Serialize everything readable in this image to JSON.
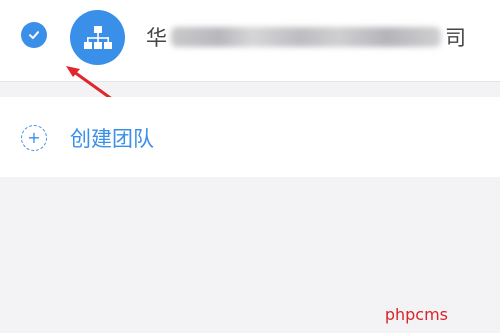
{
  "organization": {
    "check_icon": "check-circle-icon",
    "avatar_icon": "org-chart-icon",
    "name_first": "华",
    "name_last": "司"
  },
  "annotation": {
    "arrow_color": "#e0262b"
  },
  "create_team": {
    "icon": "dashed-plus-circle-icon",
    "label": "创建团队"
  },
  "watermark": "phpcms",
  "colors": {
    "accent": "#3a8fe8",
    "background": "#f3f3f6",
    "watermark": "#d8242c"
  }
}
